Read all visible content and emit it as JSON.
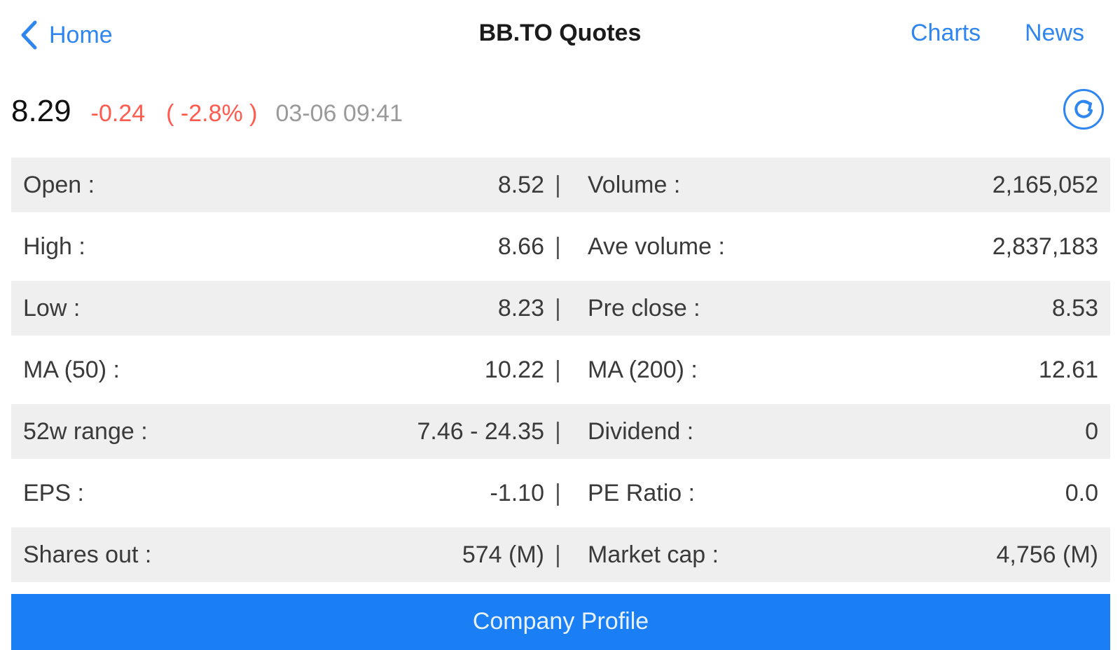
{
  "nav": {
    "back_label": "Home",
    "title": "BB.TO Quotes",
    "charts_label": "Charts",
    "news_label": "News"
  },
  "quote": {
    "price": "8.29",
    "change": "-0.24",
    "change_pct": "( -2.8% )",
    "timestamp": "03-06 09:41"
  },
  "stats": [
    {
      "left_label": "Open :",
      "left_value": "8.52",
      "sep": "|",
      "right_label": "Volume :",
      "right_value": "2,165,052"
    },
    {
      "left_label": "High :",
      "left_value": "8.66",
      "sep": "|",
      "right_label": "Ave volume :",
      "right_value": "2,837,183"
    },
    {
      "left_label": "Low :",
      "left_value": "8.23",
      "sep": "|",
      "right_label": "Pre close :",
      "right_value": "8.53"
    },
    {
      "left_label": "MA (50) :",
      "left_value": "10.22",
      "sep": "|",
      "right_label": "MA (200) :",
      "right_value": "12.61"
    },
    {
      "left_label": "52w range :",
      "left_value": "7.46 - 24.35",
      "sep": "|",
      "right_label": "Dividend :",
      "right_value": "0"
    },
    {
      "left_label": "EPS :",
      "left_value": "-1.10",
      "sep": "|",
      "right_label": "PE Ratio :",
      "right_value": "0.0"
    },
    {
      "left_label": "Shares out :",
      "left_value": "574 (M)",
      "sep": "|",
      "right_label": "Market cap :",
      "right_value": "4,756 (M)"
    }
  ],
  "company_profile_label": "Company Profile",
  "colors": {
    "accent": "#2f86f0",
    "negative": "#ff5a4d",
    "button": "#1a7ff5",
    "row_shade": "#efefef"
  },
  "icons": {
    "back": "chevron-left-icon",
    "refresh": "refresh-icon"
  }
}
